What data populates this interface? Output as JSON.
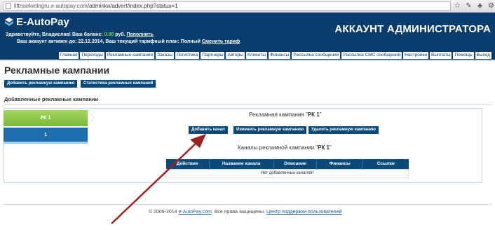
{
  "browser": {
    "url_host": "liftmarketingru.e-autopay.com",
    "url_path": "/adminka/advert/index.php?status=1",
    "icons": [
      "page-icon",
      "star-icon",
      "extension-icon",
      "puzzle-icon",
      "wrench-icon"
    ]
  },
  "header": {
    "logo_text": "E-AutoPay",
    "welcome_prefix": "Здравствуйте, Владислав!  Ваш баланс: ",
    "balance": "0.00",
    "balance_suffix": " руб. ",
    "topup_link": "Пополнить",
    "account_prefix": "Ваш аккаунт активен до: 22.12.2014, Ваш текущий тарифный план: Полный ",
    "change_plan_link": "Сменить тариф",
    "admin_title": "АККАУНТ АДМИНИСТРАТОРА"
  },
  "nav": {
    "items": [
      "Главная",
      "Переходы",
      "Рекламные кампании",
      "Заказы",
      "Логистика",
      "Партнеры",
      "Авторы",
      "Клиенты",
      "Финансы",
      "Рассылка сообщений",
      "Рассылка СМС сообщений",
      "Настройки",
      "Выплаты",
      "Помощь",
      "Выход"
    ]
  },
  "page": {
    "title": "Рекламные кампании",
    "add_campaign_button": "Добавить рекламную кампанию",
    "stats_button": "Статистика рекламных кампаний",
    "section_title": "Добавленные рекламные кампании"
  },
  "campaign": {
    "tab_active": "РК 1",
    "tab_number": "1",
    "heading_prefix": "Рекламная кампания \"",
    "heading_name": "РК 1",
    "heading_suffix": "\"",
    "add_channel_button": "Добавить канал",
    "edit_button": "Изменить рекламную кампанию",
    "delete_button": "Удалить рекламную кампанию",
    "channels_prefix": "Каналы рекламной кампании \"",
    "channels_name": "РК 1",
    "channels_suffix": "\""
  },
  "table": {
    "columns": [
      "Действие",
      "Название канала",
      "Описание",
      "Финансы",
      "Ссылки"
    ],
    "empty_message": "Нет добавленных каналов!"
  },
  "footer": {
    "copyright_prefix": "© 2009-2014 ",
    "site_link": "e-AutoPay.com",
    "copyright_mid": ". Все права защищены. ",
    "support_link": "Центр поддержки пользователей"
  },
  "colors": {
    "header_bg": "#0a3d6b",
    "button_bg": "#0a4a7a",
    "tab_green": "#7bb83a",
    "tab_blue": "#1f6fb0",
    "balance_green": "#6fdc3a",
    "annotation_arrow": "#a0201c"
  }
}
